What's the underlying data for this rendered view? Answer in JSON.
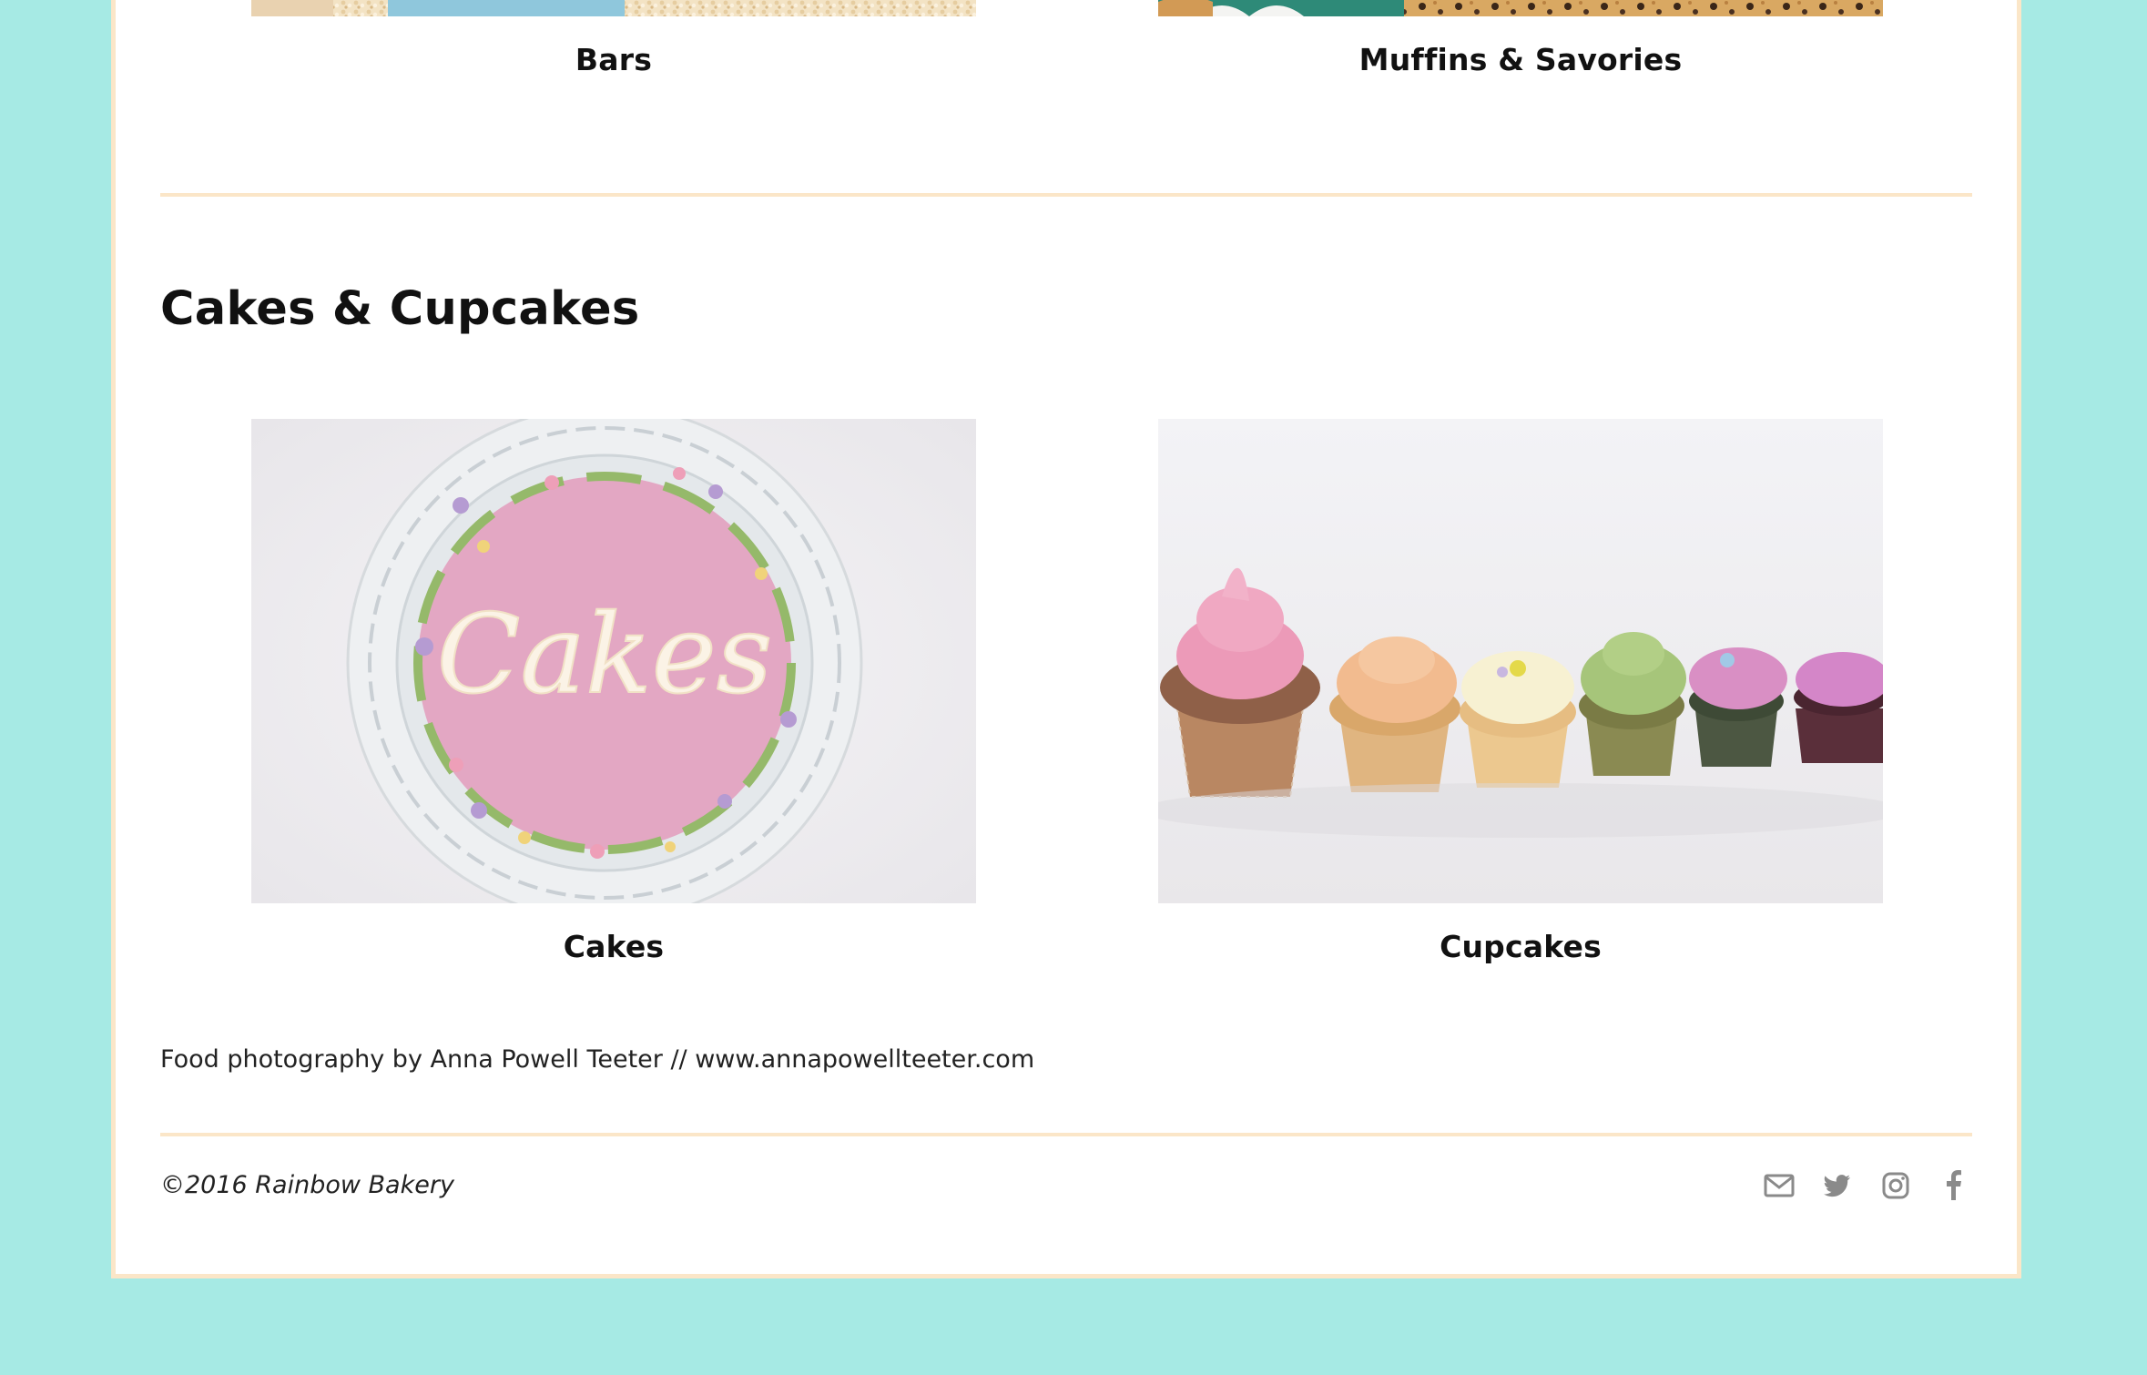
{
  "top_row": [
    {
      "label": "Bars"
    },
    {
      "label": "Muffins & Savories"
    }
  ],
  "section": {
    "title": "Cakes & Cupcakes",
    "items": [
      {
        "label": "Cakes",
        "cake_lettering": "Cakes"
      },
      {
        "label": "Cupcakes"
      }
    ]
  },
  "credit": "Food photography by Anna Powell Teeter // www.annapowellteeter.com",
  "footer": {
    "copyright": "©2016 Rainbow Bakery",
    "social_icons": [
      "email-icon",
      "twitter-icon",
      "instagram-icon",
      "facebook-icon"
    ]
  },
  "colors": {
    "page_background": "#a6eae4",
    "accent_border": "#fbe6c8",
    "icon_gray": "#8a8a8a"
  }
}
